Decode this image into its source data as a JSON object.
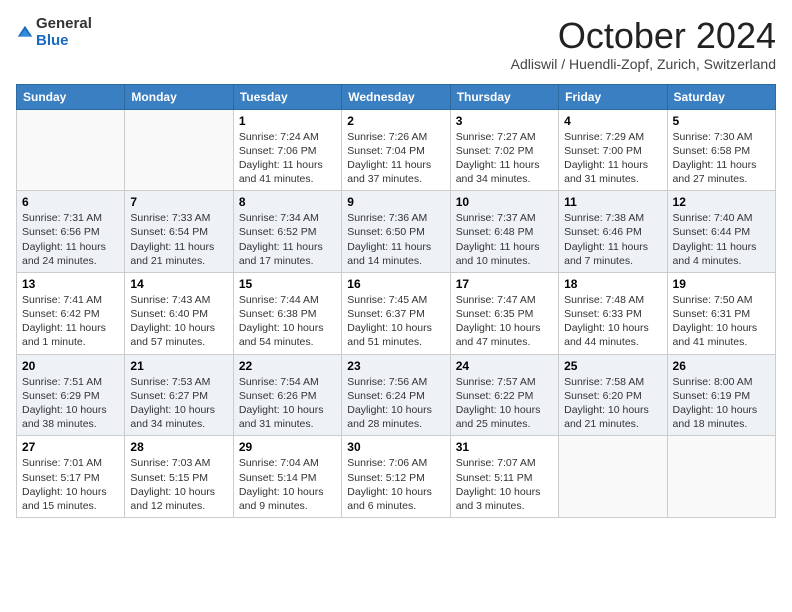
{
  "header": {
    "logo_general": "General",
    "logo_blue": "Blue",
    "month_title": "October 2024",
    "subtitle": "Adliswil / Huendli-Zopf, Zurich, Switzerland"
  },
  "days_of_week": [
    "Sunday",
    "Monday",
    "Tuesday",
    "Wednesday",
    "Thursday",
    "Friday",
    "Saturday"
  ],
  "weeks": [
    [
      {
        "day": "",
        "info": ""
      },
      {
        "day": "",
        "info": ""
      },
      {
        "day": "1",
        "info": "Sunrise: 7:24 AM\nSunset: 7:06 PM\nDaylight: 11 hours and 41 minutes."
      },
      {
        "day": "2",
        "info": "Sunrise: 7:26 AM\nSunset: 7:04 PM\nDaylight: 11 hours and 37 minutes."
      },
      {
        "day": "3",
        "info": "Sunrise: 7:27 AM\nSunset: 7:02 PM\nDaylight: 11 hours and 34 minutes."
      },
      {
        "day": "4",
        "info": "Sunrise: 7:29 AM\nSunset: 7:00 PM\nDaylight: 11 hours and 31 minutes."
      },
      {
        "day": "5",
        "info": "Sunrise: 7:30 AM\nSunset: 6:58 PM\nDaylight: 11 hours and 27 minutes."
      }
    ],
    [
      {
        "day": "6",
        "info": "Sunrise: 7:31 AM\nSunset: 6:56 PM\nDaylight: 11 hours and 24 minutes."
      },
      {
        "day": "7",
        "info": "Sunrise: 7:33 AM\nSunset: 6:54 PM\nDaylight: 11 hours and 21 minutes."
      },
      {
        "day": "8",
        "info": "Sunrise: 7:34 AM\nSunset: 6:52 PM\nDaylight: 11 hours and 17 minutes."
      },
      {
        "day": "9",
        "info": "Sunrise: 7:36 AM\nSunset: 6:50 PM\nDaylight: 11 hours and 14 minutes."
      },
      {
        "day": "10",
        "info": "Sunrise: 7:37 AM\nSunset: 6:48 PM\nDaylight: 11 hours and 10 minutes."
      },
      {
        "day": "11",
        "info": "Sunrise: 7:38 AM\nSunset: 6:46 PM\nDaylight: 11 hours and 7 minutes."
      },
      {
        "day": "12",
        "info": "Sunrise: 7:40 AM\nSunset: 6:44 PM\nDaylight: 11 hours and 4 minutes."
      }
    ],
    [
      {
        "day": "13",
        "info": "Sunrise: 7:41 AM\nSunset: 6:42 PM\nDaylight: 11 hours and 1 minute."
      },
      {
        "day": "14",
        "info": "Sunrise: 7:43 AM\nSunset: 6:40 PM\nDaylight: 10 hours and 57 minutes."
      },
      {
        "day": "15",
        "info": "Sunrise: 7:44 AM\nSunset: 6:38 PM\nDaylight: 10 hours and 54 minutes."
      },
      {
        "day": "16",
        "info": "Sunrise: 7:45 AM\nSunset: 6:37 PM\nDaylight: 10 hours and 51 minutes."
      },
      {
        "day": "17",
        "info": "Sunrise: 7:47 AM\nSunset: 6:35 PM\nDaylight: 10 hours and 47 minutes."
      },
      {
        "day": "18",
        "info": "Sunrise: 7:48 AM\nSunset: 6:33 PM\nDaylight: 10 hours and 44 minutes."
      },
      {
        "day": "19",
        "info": "Sunrise: 7:50 AM\nSunset: 6:31 PM\nDaylight: 10 hours and 41 minutes."
      }
    ],
    [
      {
        "day": "20",
        "info": "Sunrise: 7:51 AM\nSunset: 6:29 PM\nDaylight: 10 hours and 38 minutes."
      },
      {
        "day": "21",
        "info": "Sunrise: 7:53 AM\nSunset: 6:27 PM\nDaylight: 10 hours and 34 minutes."
      },
      {
        "day": "22",
        "info": "Sunrise: 7:54 AM\nSunset: 6:26 PM\nDaylight: 10 hours and 31 minutes."
      },
      {
        "day": "23",
        "info": "Sunrise: 7:56 AM\nSunset: 6:24 PM\nDaylight: 10 hours and 28 minutes."
      },
      {
        "day": "24",
        "info": "Sunrise: 7:57 AM\nSunset: 6:22 PM\nDaylight: 10 hours and 25 minutes."
      },
      {
        "day": "25",
        "info": "Sunrise: 7:58 AM\nSunset: 6:20 PM\nDaylight: 10 hours and 21 minutes."
      },
      {
        "day": "26",
        "info": "Sunrise: 8:00 AM\nSunset: 6:19 PM\nDaylight: 10 hours and 18 minutes."
      }
    ],
    [
      {
        "day": "27",
        "info": "Sunrise: 7:01 AM\nSunset: 5:17 PM\nDaylight: 10 hours and 15 minutes."
      },
      {
        "day": "28",
        "info": "Sunrise: 7:03 AM\nSunset: 5:15 PM\nDaylight: 10 hours and 12 minutes."
      },
      {
        "day": "29",
        "info": "Sunrise: 7:04 AM\nSunset: 5:14 PM\nDaylight: 10 hours and 9 minutes."
      },
      {
        "day": "30",
        "info": "Sunrise: 7:06 AM\nSunset: 5:12 PM\nDaylight: 10 hours and 6 minutes."
      },
      {
        "day": "31",
        "info": "Sunrise: 7:07 AM\nSunset: 5:11 PM\nDaylight: 10 hours and 3 minutes."
      },
      {
        "day": "",
        "info": ""
      },
      {
        "day": "",
        "info": ""
      }
    ]
  ]
}
